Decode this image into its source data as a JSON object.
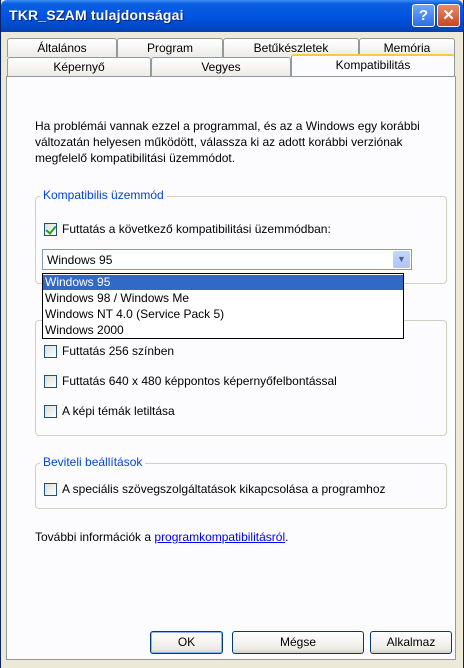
{
  "window": {
    "title": "TKR_SZAM tulajdonságai",
    "help_label": "?",
    "close_label": "✕"
  },
  "tabs": {
    "row_back": [
      "Általános",
      "Program",
      "Betűkészletek",
      "Memória"
    ],
    "row_front": [
      "Képernyő",
      "Vegyes",
      "Kompatibilitás"
    ],
    "active": "Kompatibilitás"
  },
  "description": "Ha problémái vannak ezzel a programmal, és az a Windows egy korábbi változatán helyesen működött, válassza ki az adott korábbi verziónak megfelelő kompatibilitási üzemmódot.",
  "compat_group": {
    "label": "Kompatibilis üzemmód",
    "checkbox_label": "Futtatás a következő kompatibilitási üzemmódban:",
    "checked": true,
    "selected_value": "Windows 95",
    "options": [
      "Windows 95",
      "Windows 98 / Windows Me",
      "Windows NT 4.0 (Service Pack 5)",
      "Windows 2000"
    ]
  },
  "display_group": {
    "items": [
      {
        "label": "Futtatás 256 színben",
        "checked": false
      },
      {
        "label": "Futtatás 640 x 480 képpontos képernyőfelbontással",
        "checked": false
      },
      {
        "label": "A képi témák letiltása",
        "checked": false
      }
    ]
  },
  "input_group": {
    "label": "Beviteli beállítások",
    "checkbox_label": "A speciális szövegszolgáltatások kikapcsolása a programhoz",
    "checked": false
  },
  "more_info": {
    "prefix": "További információk a ",
    "link": "programkompatibilitásról",
    "suffix": "."
  },
  "buttons": {
    "ok": "OK",
    "cancel": "Mégse",
    "apply": "Alkalmaz"
  },
  "colors": {
    "titlebar": "#0054e3",
    "group_label": "#0046d5",
    "selection": "#316ac5"
  }
}
